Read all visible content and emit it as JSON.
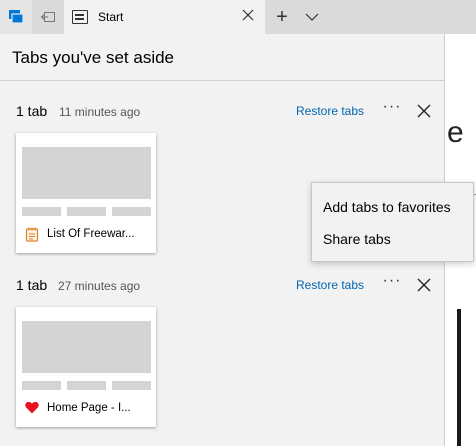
{
  "tabbar": {
    "active_tab_title": "Start",
    "new_tab_glyph": "+"
  },
  "panel": {
    "title": "Tabs you've set aside",
    "groups": [
      {
        "count_label": "1 tab",
        "time_label": "11 minutes ago",
        "restore_label": "Restore tabs",
        "more_label": "···",
        "tab": {
          "title": "List Of Freewar...",
          "icon": "notepad-icon"
        }
      },
      {
        "count_label": "1 tab",
        "time_label": "27 minutes ago",
        "restore_label": "Restore tabs",
        "more_label": "···",
        "tab": {
          "title": "Home Page - I...",
          "icon": "heart-icon"
        }
      }
    ]
  },
  "context_menu": {
    "items": [
      "Add tabs to favorites",
      "Share tabs"
    ]
  },
  "colors": {
    "accent": "#0078d7",
    "link": "#0066b4",
    "heart": "#e81123",
    "notepad": "#d9822b"
  }
}
